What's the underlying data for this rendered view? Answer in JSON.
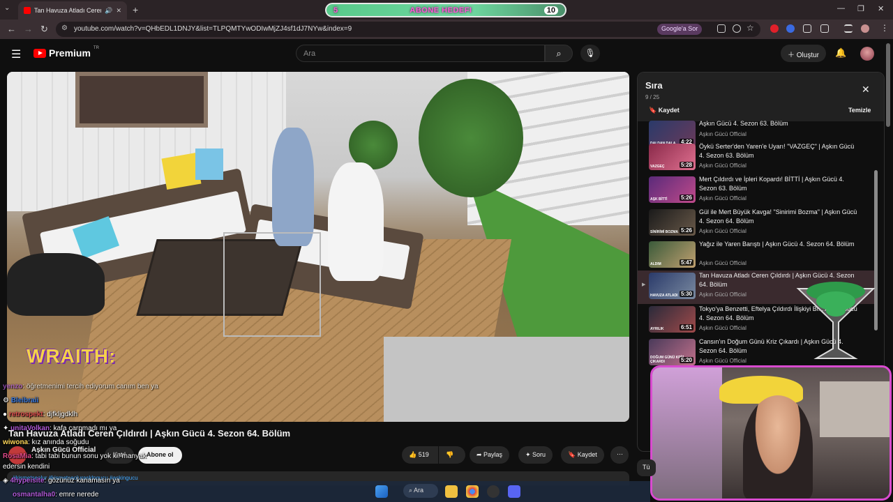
{
  "browser": {
    "tab_title": "Tan Havuza Atladı Ceren Çıl...",
    "url": "youtube.com/watch?v=QHbEDL1DNJY&list=TLPQMTYwODIwMjZJ4sf1dJ7NYw&index=9",
    "google_button": "Google'a Sor"
  },
  "goal_overlay": {
    "start": "5",
    "label": "ABONE HEDEFI",
    "end": "10",
    "progress": 0.5
  },
  "youtube": {
    "logo_text": "Premium",
    "logo_sup": "TR",
    "search_placeholder": "Ara",
    "create_label": "Oluştur"
  },
  "video": {
    "title": "Tan Havuza Atladı Ceren Çıldırdı | Aşkın Gücü 4. Sezon 64. Bölüm",
    "channel": "Aşkın Gücü Official",
    "subscribers": "",
    "join_label": "Katıl",
    "subscribe_label": "Abone ol",
    "likes": "519",
    "share_label": "Paylaş",
    "ask_label": "Soru",
    "save_label": "Kaydet",
    "description_tags": "#kismetseolur #kismetseolurasklngucu #askingucu",
    "watermark": "WRAITH:"
  },
  "chat": [
    {
      "user": "yenzo",
      "text": ": öğretmenimi tercih ediyorum canım ben ya"
    },
    {
      "user": "Bleibraii",
      "text": ""
    },
    {
      "user": "retrospekt",
      "text": ": djfkljgdklh"
    },
    {
      "user": "unitaVolkan",
      "text": ": kafa çarpmadı mı ya"
    },
    {
      "user": "wiwona",
      "text": ": kız anında soğudu"
    },
    {
      "user": "RosaMia",
      "text": ": tabi tabi bunun sonu yok ki. manyak"
    },
    {
      "user": "",
      "text": "edersin kendini"
    },
    {
      "user": "4hypeisite",
      "text": ": gözünüz kanamasın ya"
    },
    {
      "user": "osmantalha0",
      "text": ": emre nerede"
    }
  ],
  "playlist": {
    "title": "Sıra",
    "position": "9 / 25",
    "save_label": "Kaydet",
    "clear_label": "Temizle",
    "items": [
      {
        "title": "Aşkın Gücü 4. Sezon 63. Bölüm",
        "channel": "Aşkın Gücü Official",
        "duration": "4:22",
        "caption": "DALDAN DALA"
      },
      {
        "title": "Öykü Serter'den Yaren'e Uyarı! \"VAZGEÇ\" | Aşkın Gücü 4. Sezon 63. Bölüm",
        "channel": "Aşkın Gücü Official",
        "duration": "5:28",
        "caption": "VAZGEÇ"
      },
      {
        "title": "Mert Çıldırdı ve İpleri Kopardı! BİTTİ | Aşkın Gücü 4. Sezon 63. Bölüm",
        "channel": "Aşkın Gücü Official",
        "duration": "5:26",
        "caption": "AŞK BİTTİ"
      },
      {
        "title": "Gül ile Mert Büyük Kavga! \"Sinirimi Bozma\" | Aşkın Gücü 4. Sezon 64. Bölüm",
        "channel": "Aşkın Gücü Official",
        "duration": "5:26",
        "caption": "SİNİRİMİ BOZMA"
      },
      {
        "title": "Yağız ile Yaren Barıştı | Aşkın Gücü 4. Sezon 64. Bölüm",
        "channel": "Aşkın Gücü Official",
        "duration": "5:47",
        "caption": "ALDIM"
      },
      {
        "title": "Tan Havuza Atladı Ceren Çıldırdı | Aşkın Gücü 4. Sezon 64. Bölüm",
        "channel": "Aşkın Gücü Official",
        "duration": "5:30",
        "caption": "HAVUZA ATLADI"
      },
      {
        "title": "Tokyo'ya Benzetti, Eftelya Çıldırdı İlişkiyi Bi... Aşkın Gücü 4. Sezon 64. Bölüm",
        "channel": "Aşkın Gücü Official",
        "duration": "6:51",
        "caption": "AYRILIK"
      },
      {
        "title": "Cansın'ın Doğum Günü Kriz Çıkardı | Aşkın Gücü 4. Sezon 64. Bölüm",
        "channel": "Aşkın Gücü Official",
        "duration": "5:20",
        "caption": "DOĞUM GÜNÜ KRİZ ÇIKARDI"
      }
    ]
  },
  "taskbar": {
    "search_label": "Ara",
    "tumu_label": "Tü"
  },
  "colors": {
    "accent_red": "#ff0000",
    "webcam_border": "#d94bd0",
    "goal_green": "#58c98a"
  }
}
